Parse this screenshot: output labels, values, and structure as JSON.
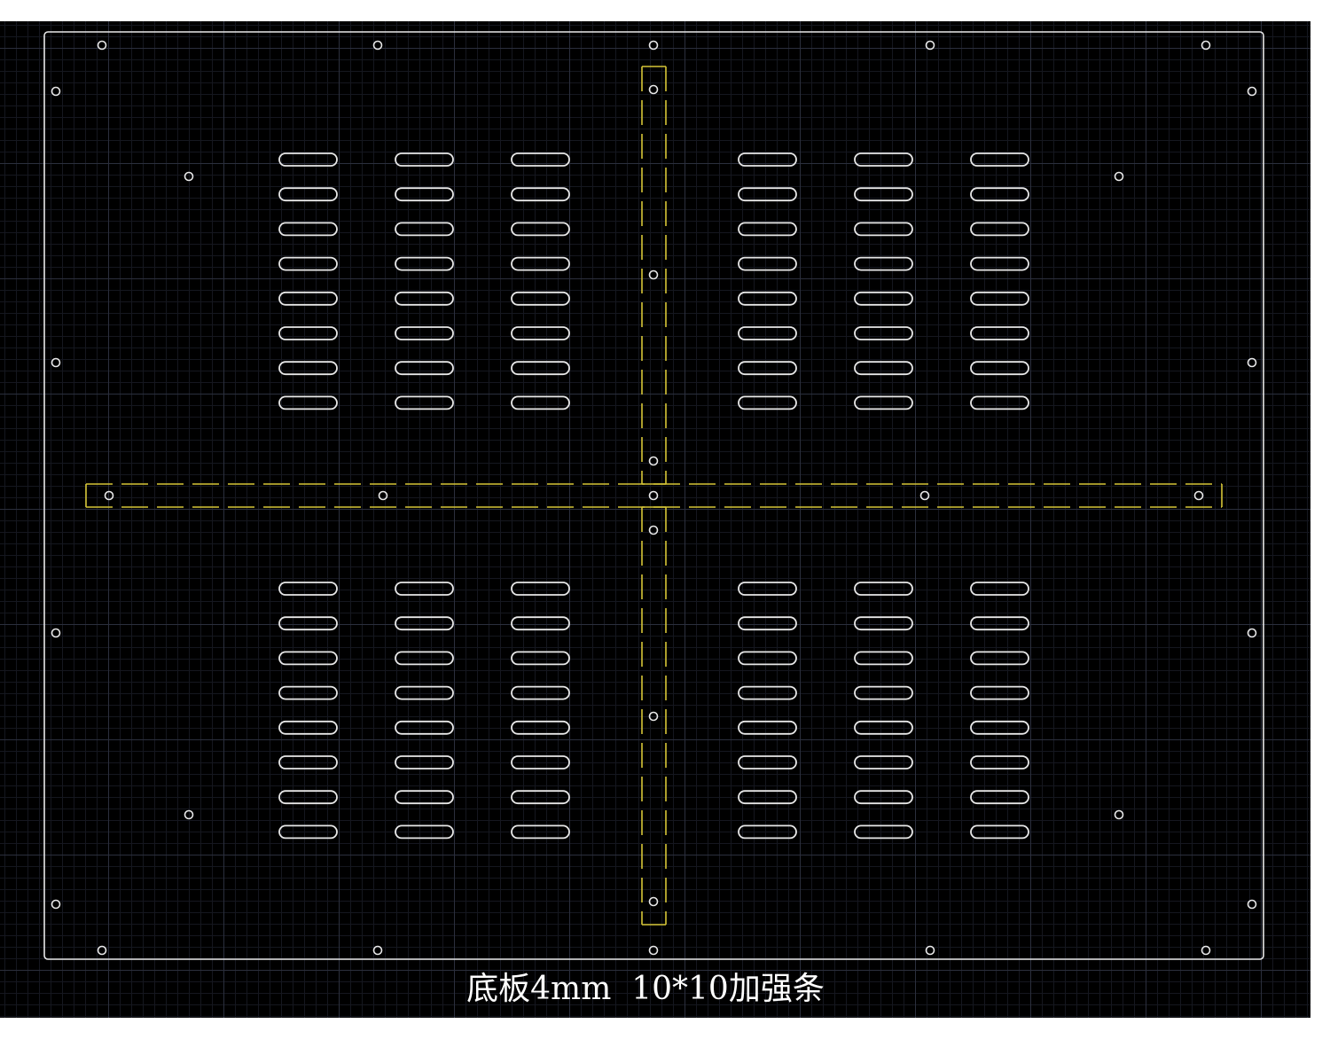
{
  "caption": "底板4mm  10*10加强条",
  "colors": {
    "background": "#000000",
    "grid_major": "#2b2f3d",
    "grid_minor": "#15171f",
    "outline": "#e8e8e8",
    "stiffener": "#d6c637"
  },
  "counts": {
    "slot_groups": 4,
    "slot_columns_per_group": 3,
    "slot_rows_per_group": 8
  }
}
